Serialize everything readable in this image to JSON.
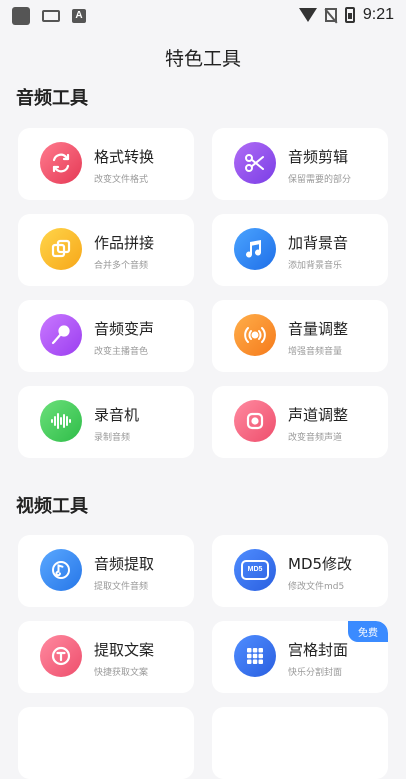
{
  "status": {
    "time": "9:21",
    "left_a": "A"
  },
  "page_title": "特色工具",
  "sections": {
    "audio": "音频工具",
    "video": "视频工具"
  },
  "audio_tools": [
    {
      "name": "格式转换",
      "desc": "改变文件格式",
      "icon": "swap-icon",
      "color": "#e53955"
    },
    {
      "name": "音频剪辑",
      "desc": "保留需要的部分",
      "icon": "scissors-icon",
      "color": "#7a3ee6"
    },
    {
      "name": "作品拼接",
      "desc": "合并多个音频",
      "icon": "merge-icon",
      "color": "#f7a719"
    },
    {
      "name": "加背景音",
      "desc": "添加背景音乐",
      "icon": "music-note-icon",
      "color": "#1f6fe8"
    },
    {
      "name": "音频变声",
      "desc": "改变主播音色",
      "icon": "microphone-icon",
      "color": "#9b3ef0"
    },
    {
      "name": "音量调整",
      "desc": "增强音频音量",
      "icon": "volume-waves-icon",
      "color": "#f57a1b"
    },
    {
      "name": "录音机",
      "desc": "录制音频",
      "icon": "waveform-icon",
      "color": "#2fbd49"
    },
    {
      "name": "声道调整",
      "desc": "改变音频声道",
      "icon": "record-icon",
      "color": "#ee4e6c"
    }
  ],
  "video_tools": [
    {
      "name": "音频提取",
      "desc": "提取文件音频",
      "icon": "extract-note-icon",
      "color": "#2676e8"
    },
    {
      "name": "MD5修改",
      "desc": "修改文件md5",
      "icon": "md5-icon",
      "color": "#2a5fe0",
      "md5_label": "MD5"
    },
    {
      "name": "提取文案",
      "desc": "快捷获取文案",
      "icon": "text-extract-icon",
      "color": "#ee4e6c"
    },
    {
      "name": "宫格封面",
      "desc": "快乐分割封面",
      "icon": "grid-icon",
      "color": "#2a5fe0",
      "badge": "免费"
    }
  ]
}
